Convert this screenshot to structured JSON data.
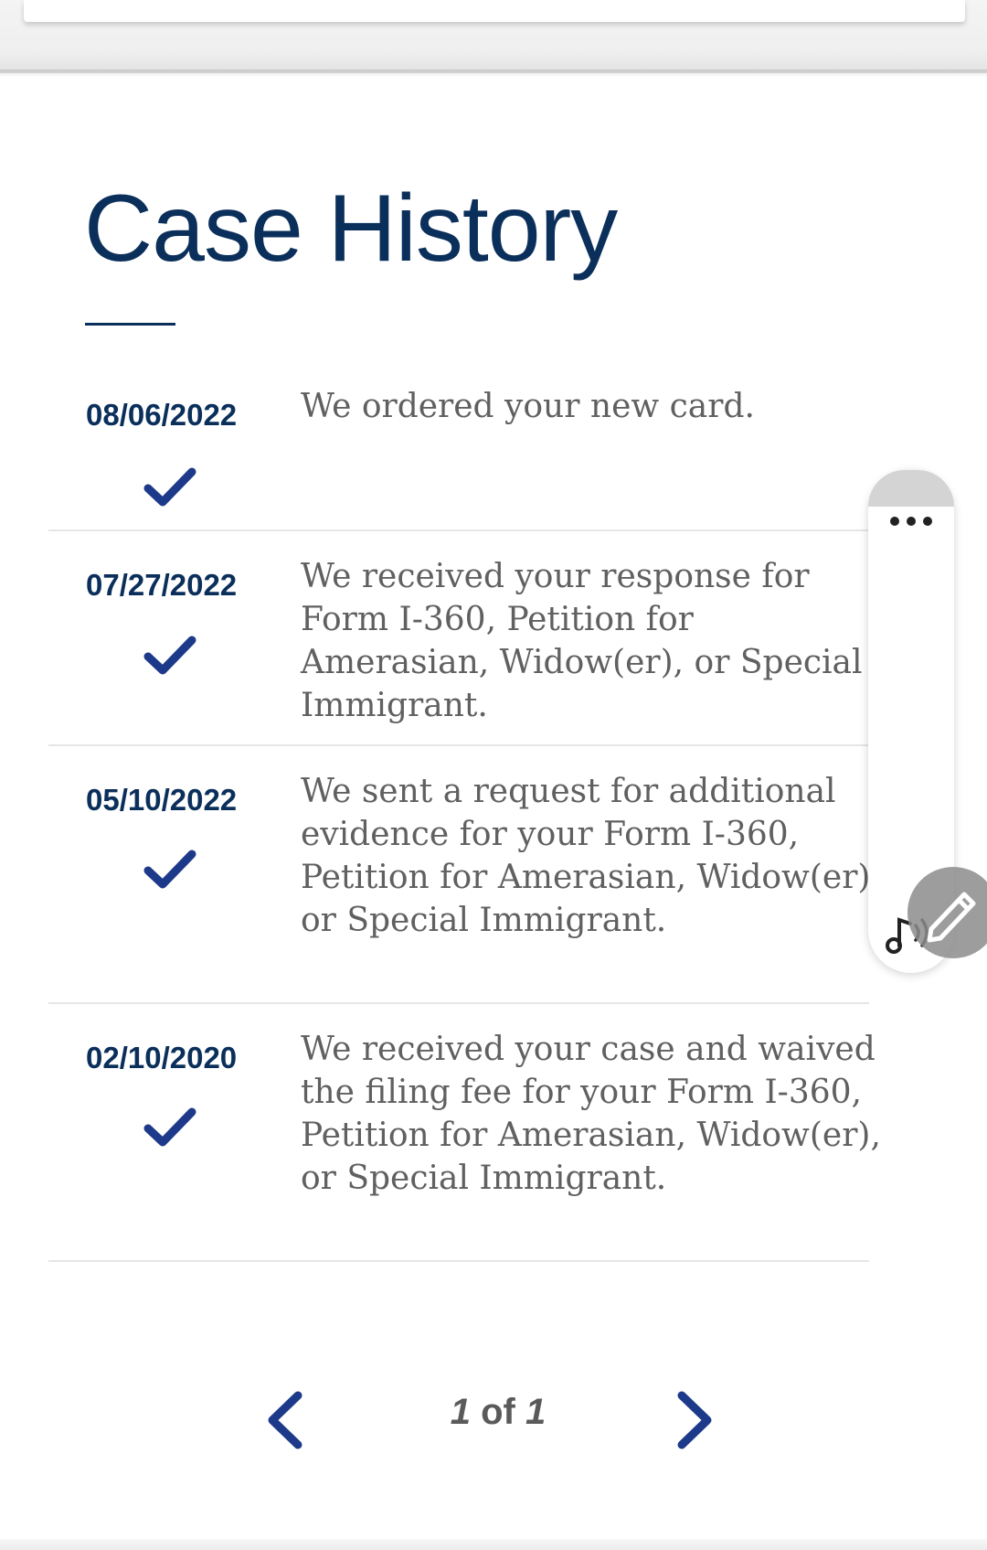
{
  "page": {
    "title": "Case History"
  },
  "history": [
    {
      "date": "08/06/2022",
      "text": "We ordered your new card."
    },
    {
      "date": "07/27/2022",
      "text": "We received your response for Form I-360, Petition for Amerasian, Widow(er), or Special Immigrant."
    },
    {
      "date": "05/10/2022",
      "text": "We sent a request for additional evidence for your Form I-360, Petition for Amerasian, Widow(er), or Special Immigrant."
    },
    {
      "date": "02/10/2020",
      "text": "We received your case and waived the filing fee for your Form I-360, Petition for Amerasian, Widow(er), or Special Immigrant."
    }
  ],
  "pagination": {
    "current": "1",
    "separator": "of",
    "total": "1"
  },
  "icons": {
    "check": "checkmark-icon",
    "prev": "chevron-left-icon",
    "next": "chevron-right-icon",
    "menu": "more-dots-icon",
    "audio": "read-aloud-icon",
    "edit": "pencil-icon"
  },
  "colors": {
    "brand_navy": "#0b2f5b",
    "check_blue": "#1d3a8a",
    "body_text": "#606060",
    "divider": "#e6e6e6"
  }
}
